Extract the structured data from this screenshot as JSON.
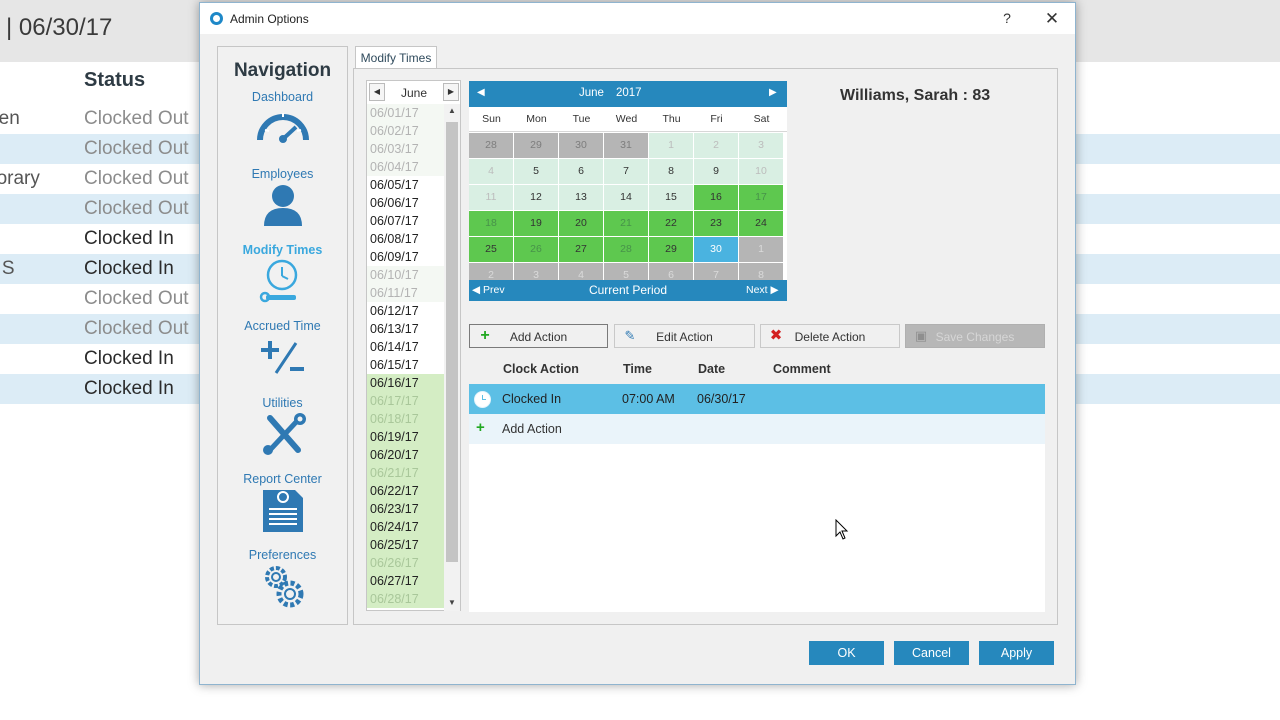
{
  "background": {
    "date": "|  06/30/17",
    "status_header": "Status",
    "rows": [
      {
        "name": "rren",
        "status": "Clocked Out",
        "state": "out",
        "alt": false
      },
      {
        "name": "",
        "status": "Clocked Out",
        "state": "out",
        "alt": true
      },
      {
        "name": "porary",
        "status": "Clocked Out",
        "state": "out",
        "alt": false
      },
      {
        "name": "",
        "status": "Clocked Out",
        "state": "out",
        "alt": true
      },
      {
        "name": "",
        "status": "Clocked In",
        "state": "in",
        "alt": false
      },
      {
        "name": "n S",
        "status": "Clocked In",
        "state": "in",
        "alt": true
      },
      {
        "name": "",
        "status": "Clocked Out",
        "state": "out",
        "alt": false
      },
      {
        "name": "",
        "status": "Clocked Out",
        "state": "out",
        "alt": true
      },
      {
        "name": "",
        "status": "Clocked In",
        "state": "in",
        "alt": false
      },
      {
        "name": "",
        "status": "Clocked In",
        "state": "in",
        "alt": true
      }
    ]
  },
  "dialog": {
    "title": "Admin Options",
    "help": "?",
    "close": "✕"
  },
  "nav": {
    "title": "Navigation",
    "items": [
      {
        "label": "Dashboard",
        "icon": "dashboard-icon",
        "active": false
      },
      {
        "label": "Employees",
        "icon": "employees-icon",
        "active": false
      },
      {
        "label": "Modify Times",
        "icon": "modify-times-icon",
        "active": true
      },
      {
        "label": "Accrued Time",
        "icon": "accrued-time-icon",
        "active": false
      },
      {
        "label": "Utilities",
        "icon": "utilities-icon",
        "active": false
      },
      {
        "label": "Report Center",
        "icon": "report-center-icon",
        "active": false
      },
      {
        "label": "Preferences",
        "icon": "preferences-icon",
        "active": false
      }
    ]
  },
  "tab": {
    "label": "Modify Times"
  },
  "date_list": {
    "month": "June",
    "prev": "◀",
    "next": "▶",
    "items": [
      {
        "date": "06/01/17",
        "style": "dim"
      },
      {
        "date": "06/02/17",
        "style": "dim"
      },
      {
        "date": "06/03/17",
        "style": "dim"
      },
      {
        "date": "06/04/17",
        "style": "dim"
      },
      {
        "date": "06/05/17",
        "style": ""
      },
      {
        "date": "06/06/17",
        "style": ""
      },
      {
        "date": "06/07/17",
        "style": ""
      },
      {
        "date": "06/08/17",
        "style": ""
      },
      {
        "date": "06/09/17",
        "style": ""
      },
      {
        "date": "06/10/17",
        "style": "dim"
      },
      {
        "date": "06/11/17",
        "style": "dim"
      },
      {
        "date": "06/12/17",
        "style": ""
      },
      {
        "date": "06/13/17",
        "style": ""
      },
      {
        "date": "06/14/17",
        "style": ""
      },
      {
        "date": "06/15/17",
        "style": ""
      },
      {
        "date": "06/16/17",
        "style": "g"
      },
      {
        "date": "06/17/17",
        "style": "gdim"
      },
      {
        "date": "06/18/17",
        "style": "gdim"
      },
      {
        "date": "06/19/17",
        "style": "g"
      },
      {
        "date": "06/20/17",
        "style": "g"
      },
      {
        "date": "06/21/17",
        "style": "gdim"
      },
      {
        "date": "06/22/17",
        "style": "g"
      },
      {
        "date": "06/23/17",
        "style": "g"
      },
      {
        "date": "06/24/17",
        "style": "g"
      },
      {
        "date": "06/25/17",
        "style": "g"
      },
      {
        "date": "06/26/17",
        "style": "gdim"
      },
      {
        "date": "06/27/17",
        "style": "g"
      },
      {
        "date": "06/28/17",
        "style": "gdim"
      }
    ]
  },
  "calendar": {
    "month": "June",
    "year": "2017",
    "days_of_week": [
      "Sun",
      "Mon",
      "Tue",
      "Wed",
      "Thu",
      "Fri",
      "Sat"
    ],
    "weeks": [
      [
        {
          "d": "28",
          "s": "grey"
        },
        {
          "d": "29",
          "s": "grey"
        },
        {
          "d": "30",
          "s": "grey"
        },
        {
          "d": "31",
          "s": "grey"
        },
        {
          "d": "1",
          "s": "pale"
        },
        {
          "d": "2",
          "s": "pale"
        },
        {
          "d": "3",
          "s": "pale"
        }
      ],
      [
        {
          "d": "4",
          "s": "pale"
        },
        {
          "d": "5",
          "s": "light"
        },
        {
          "d": "6",
          "s": "light"
        },
        {
          "d": "7",
          "s": "light"
        },
        {
          "d": "8",
          "s": "light"
        },
        {
          "d": "9",
          "s": "light"
        },
        {
          "d": "10",
          "s": "pale"
        }
      ],
      [
        {
          "d": "11",
          "s": "pale"
        },
        {
          "d": "12",
          "s": "light"
        },
        {
          "d": "13",
          "s": "light"
        },
        {
          "d": "14",
          "s": "light"
        },
        {
          "d": "15",
          "s": "light"
        },
        {
          "d": "16",
          "s": "green"
        },
        {
          "d": "17",
          "s": "greenfade"
        }
      ],
      [
        {
          "d": "18",
          "s": "greenfade"
        },
        {
          "d": "19",
          "s": "green"
        },
        {
          "d": "20",
          "s": "green"
        },
        {
          "d": "21",
          "s": "greenfade"
        },
        {
          "d": "22",
          "s": "green"
        },
        {
          "d": "23",
          "s": "green"
        },
        {
          "d": "24",
          "s": "green"
        }
      ],
      [
        {
          "d": "25",
          "s": "green"
        },
        {
          "d": "26",
          "s": "greenfade"
        },
        {
          "d": "27",
          "s": "green"
        },
        {
          "d": "28",
          "s": "greenfade"
        },
        {
          "d": "29",
          "s": "green"
        },
        {
          "d": "30",
          "s": "blue"
        },
        {
          "d": "1",
          "s": "greyfade"
        }
      ],
      [
        {
          "d": "2",
          "s": "greyfade"
        },
        {
          "d": "3",
          "s": "greyfade"
        },
        {
          "d": "4",
          "s": "greyfade"
        },
        {
          "d": "5",
          "s": "greyfade"
        },
        {
          "d": "6",
          "s": "greyfade"
        },
        {
          "d": "7",
          "s": "greyfade"
        },
        {
          "d": "8",
          "s": "greyfade"
        }
      ]
    ],
    "footer_prev": "◀  Prev",
    "footer_current": "Current Period",
    "footer_next": "Next  ▶"
  },
  "employee": {
    "name": "Williams, Sarah  : 83"
  },
  "actions": {
    "add": "Add Action",
    "edit": "Edit Action",
    "delete": "Delete Action",
    "save": "Save Changes"
  },
  "table": {
    "headers": [
      "Clock Action",
      "Time",
      "Date",
      "Comment"
    ],
    "row": {
      "action": "Clocked In",
      "time": "07:00 AM",
      "date": "06/30/17",
      "comment": ""
    },
    "add_row": "Add Action"
  },
  "buttons": {
    "ok": "OK",
    "cancel": "Cancel",
    "apply": "Apply"
  },
  "colors": {
    "accent": "#2688bd",
    "selected_row": "#5cbfe5",
    "worked_day": "#5ec84f",
    "today": "#4ab3e0"
  }
}
